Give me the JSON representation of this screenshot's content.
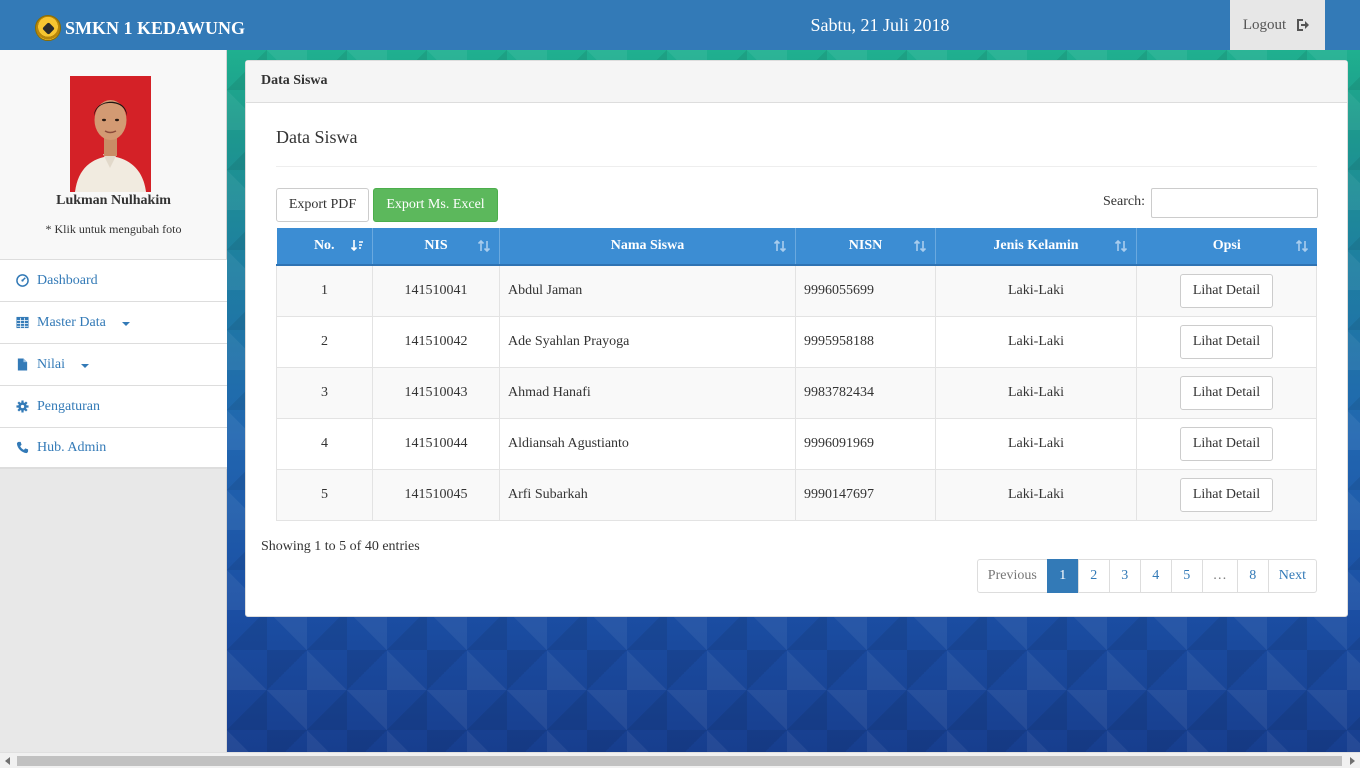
{
  "header": {
    "brand": "SMKN 1 KEDAWUNG",
    "date": "Sabtu, 21 Juli 2018",
    "logout_label": "Logout"
  },
  "sidebar": {
    "profile_name": "Lukman Nulhakim",
    "profile_hint": "* Klik untuk mengubah foto",
    "items": [
      {
        "label": "Dashboard",
        "icon": "dashboard-icon"
      },
      {
        "label": "Master Data",
        "icon": "table-icon",
        "dropdown": true
      },
      {
        "label": "Nilai",
        "icon": "file-icon",
        "dropdown": true
      },
      {
        "label": "Pengaturan",
        "icon": "gear-icon"
      },
      {
        "label": "Hub. Admin",
        "icon": "phone-icon"
      }
    ]
  },
  "panel": {
    "heading": "Data Siswa",
    "title": "Data Siswa",
    "export_pdf": "Export PDF",
    "export_excel": "Export Ms. Excel",
    "search_label": "Search:",
    "search_value": ""
  },
  "table": {
    "columns": [
      "No.",
      "NIS",
      "Nama Siswa",
      "NISN",
      "Jenis Kelamin",
      "Opsi"
    ],
    "rows": [
      {
        "no": "1",
        "nis": "141510041",
        "nama": "Abdul Jaman",
        "nisn": "9996055699",
        "jk": "Laki-Laki",
        "opsi": "Lihat Detail"
      },
      {
        "no": "2",
        "nis": "141510042",
        "nama": "Ade Syahlan Prayoga",
        "nisn": "9995958188",
        "jk": "Laki-Laki",
        "opsi": "Lihat Detail"
      },
      {
        "no": "3",
        "nis": "141510043",
        "nama": "Ahmad Hanafi",
        "nisn": "9983782434",
        "jk": "Laki-Laki",
        "opsi": "Lihat Detail"
      },
      {
        "no": "4",
        "nis": "141510044",
        "nama": "Aldiansah Agustianto",
        "nisn": "9996091969",
        "jk": "Laki-Laki",
        "opsi": "Lihat Detail"
      },
      {
        "no": "5",
        "nis": "141510045",
        "nama": "Arfi Subarkah",
        "nisn": "9990147697",
        "jk": "Laki-Laki",
        "opsi": "Lihat Detail"
      }
    ]
  },
  "footer": {
    "info": "Showing 1 to 5 of 40 entries",
    "pagination": [
      "Previous",
      "1",
      "2",
      "3",
      "4",
      "5",
      "…",
      "8",
      "Next"
    ],
    "active_page": "1"
  },
  "colors": {
    "navbar": "#337ab7",
    "table_header": "#3c8dd3",
    "success": "#5cb85c"
  }
}
